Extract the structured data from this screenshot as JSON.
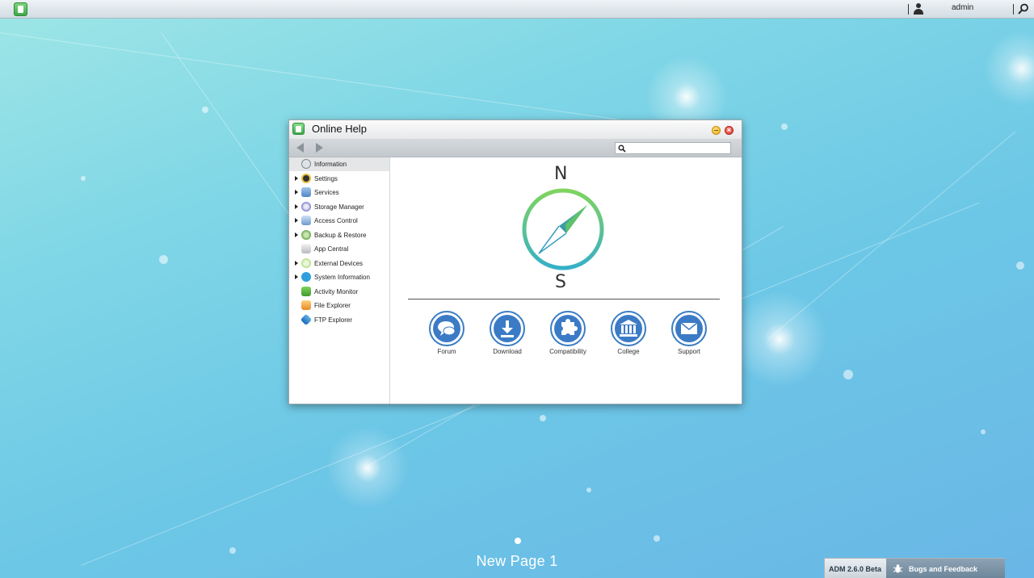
{
  "topbar": {
    "username": "admin"
  },
  "window": {
    "title": "Online Help",
    "search_placeholder": ""
  },
  "sidebar": {
    "items": [
      {
        "label": "Information",
        "icon": "information-icon",
        "expandable": false,
        "selected": true
      },
      {
        "label": "Settings",
        "icon": "settings-icon",
        "expandable": true,
        "selected": false
      },
      {
        "label": "Services",
        "icon": "services-icon",
        "expandable": true,
        "selected": false
      },
      {
        "label": "Storage Manager",
        "icon": "storage-manager-icon",
        "expandable": true,
        "selected": false
      },
      {
        "label": "Access Control",
        "icon": "access-control-icon",
        "expandable": true,
        "selected": false
      },
      {
        "label": "Backup & Restore",
        "icon": "backup-restore-icon",
        "expandable": true,
        "selected": false
      },
      {
        "label": "App Central",
        "icon": "app-central-icon",
        "expandable": false,
        "selected": false
      },
      {
        "label": "External Devices",
        "icon": "external-devices-icon",
        "expandable": true,
        "selected": false
      },
      {
        "label": "System Information",
        "icon": "system-information-icon",
        "expandable": true,
        "selected": false
      },
      {
        "label": "Activity Monitor",
        "icon": "activity-monitor-icon",
        "expandable": false,
        "selected": false
      },
      {
        "label": "File Explorer",
        "icon": "file-explorer-icon",
        "expandable": false,
        "selected": false
      },
      {
        "label": "FTP Explorer",
        "icon": "ftp-explorer-icon",
        "expandable": false,
        "selected": false
      }
    ]
  },
  "content": {
    "compass_north": "N",
    "compass_south": "S",
    "links": [
      {
        "label": "Forum",
        "icon": "forum-icon"
      },
      {
        "label": "Download",
        "icon": "download-icon"
      },
      {
        "label": "Compatibility",
        "icon": "compatibility-icon"
      },
      {
        "label": "College",
        "icon": "college-icon"
      },
      {
        "label": "Support",
        "icon": "support-icon"
      }
    ]
  },
  "desktop": {
    "page_label": "New Page 1"
  },
  "statusbar": {
    "version": "ADM 2.6.0 Beta",
    "bugs_label": "Bugs and Feedback"
  },
  "colors": {
    "accent_blue": "#3b7bc6",
    "compass_green": "#6fd16a",
    "compass_teal": "#3fb6c6"
  }
}
